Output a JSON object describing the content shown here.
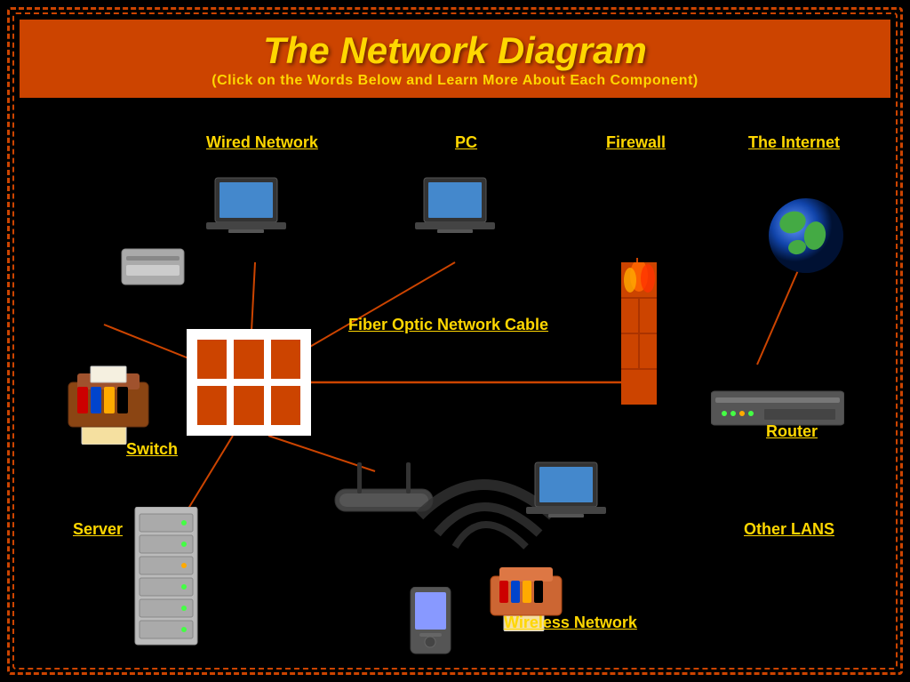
{
  "page": {
    "title": "The Network Diagram",
    "subtitle": "(Click on the Words Below and Learn More About Each Component)",
    "background_color": "#000000",
    "border_color": "#cc4400",
    "header_bg": "#cc4400",
    "title_color": "#FFD700"
  },
  "labels": {
    "wired_network": "Wired Network",
    "pc": "PC",
    "firewall": "Firewall",
    "the_internet": "The Internet",
    "fiber_optic": "Fiber Optic Network Cable",
    "switch": "Switch",
    "router": "Router",
    "server": "Server",
    "wireless_network": "Wireless Network",
    "other_lans": "Other LANS"
  }
}
